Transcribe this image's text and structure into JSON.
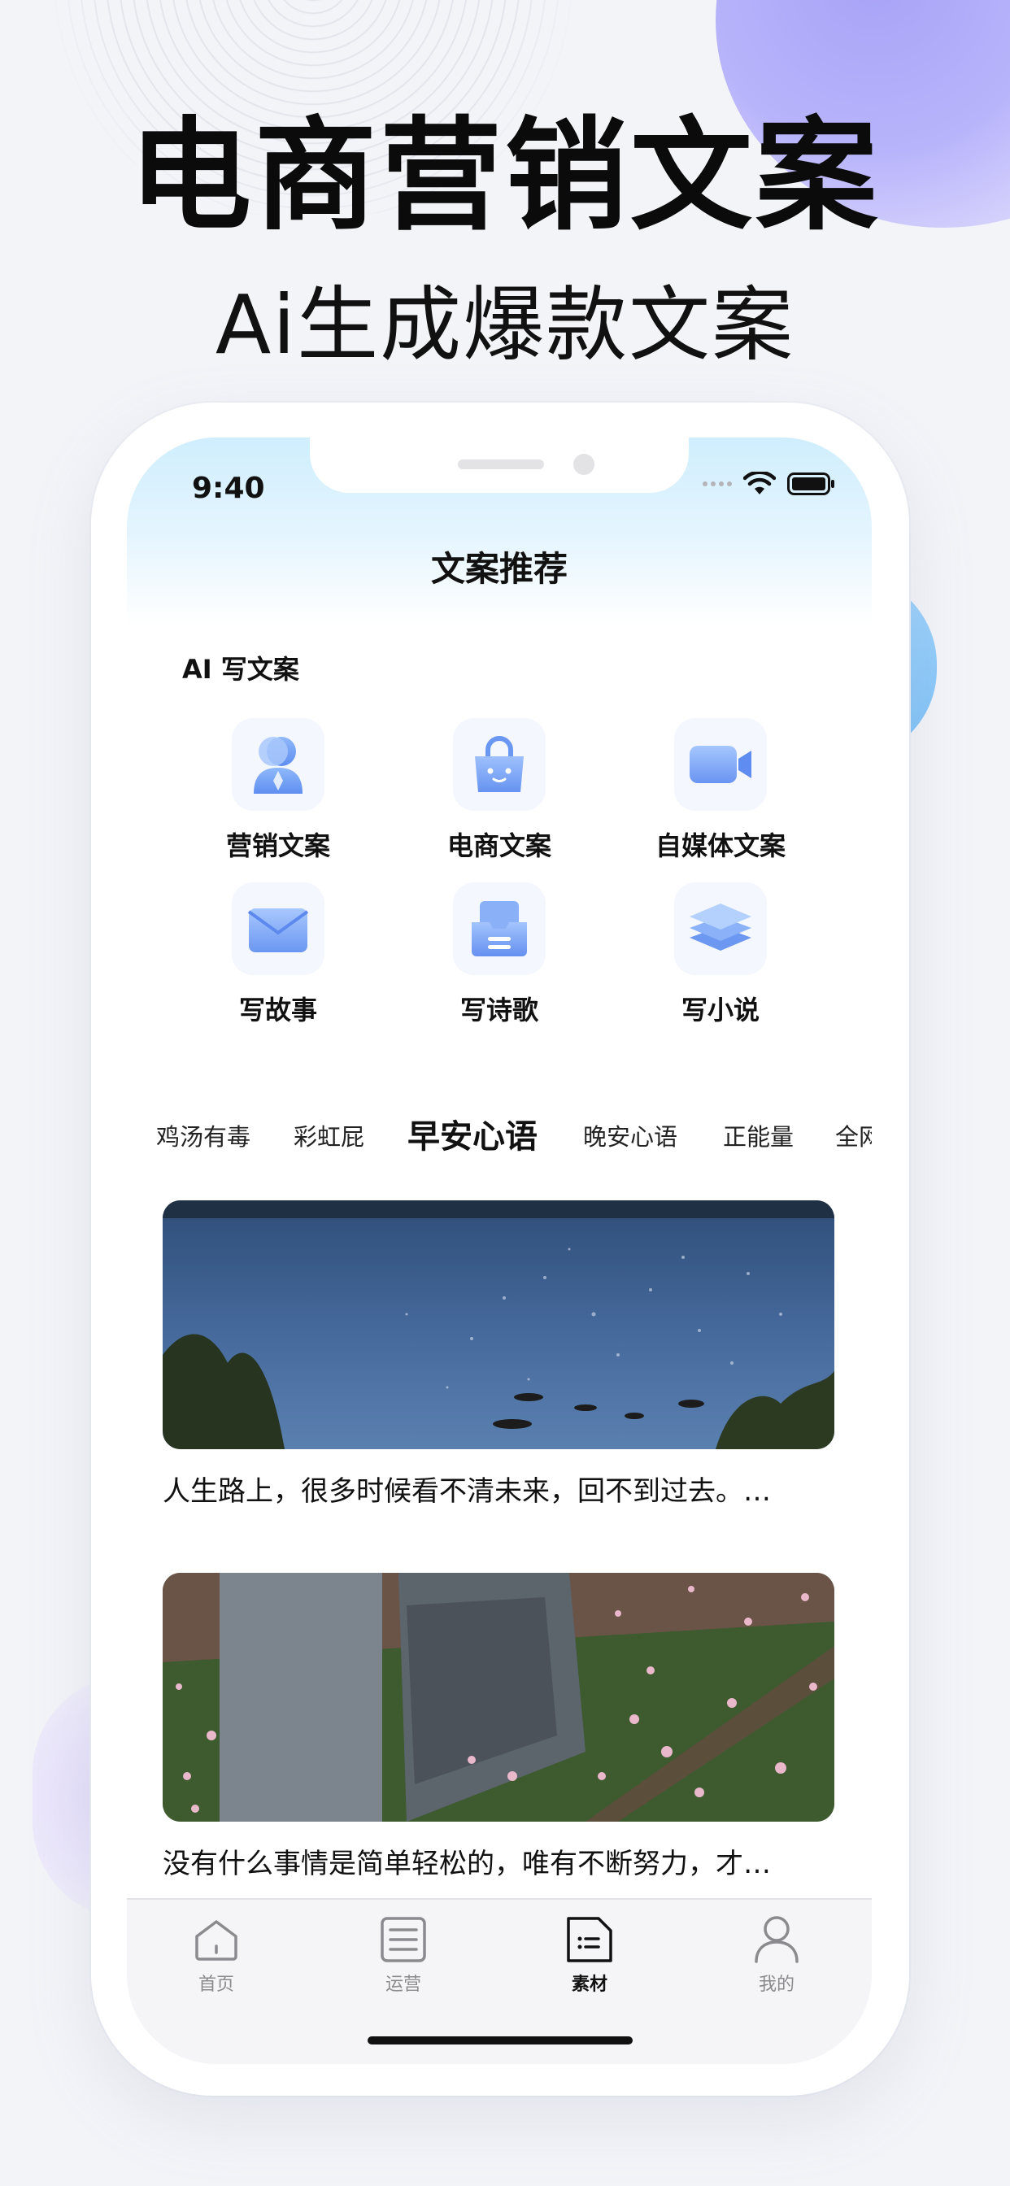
{
  "promo": {
    "headline": "电商营销文案",
    "subheadline": "Ai生成爆款文案"
  },
  "status_bar": {
    "time": "9:40"
  },
  "nav": {
    "title": "文案推荐"
  },
  "ai_section": {
    "title": "AI 写文案",
    "tools": [
      {
        "label": "营销文案",
        "icon": "person-icon"
      },
      {
        "label": "电商文案",
        "icon": "shopping-bag-icon"
      },
      {
        "label": "自媒体文案",
        "icon": "video-camera-icon"
      },
      {
        "label": "写故事",
        "icon": "envelope-icon"
      },
      {
        "label": "写诗歌",
        "icon": "inbox-icon"
      },
      {
        "label": "写小说",
        "icon": "layers-icon"
      }
    ]
  },
  "categories": {
    "items": [
      "鸡汤有毒",
      "彩虹屁",
      "早安心语",
      "晚安心语",
      "正能量",
      "全网"
    ],
    "active": "早安心语"
  },
  "feed": {
    "cards": [
      {
        "text": "人生路上，很多时候看不清未来，回不到过去。…",
        "image": "lake-photo"
      },
      {
        "text": "没有什么事情是简单轻松的，唯有不断努力，才…",
        "image": "trash-bin-petals-photo"
      }
    ]
  },
  "tabbar": {
    "items": [
      {
        "label": "首页",
        "icon": "home-icon"
      },
      {
        "label": "运营",
        "icon": "document-list-icon"
      },
      {
        "label": "素材",
        "icon": "material-file-icon"
      },
      {
        "label": "我的",
        "icon": "profile-icon"
      }
    ],
    "active": "素材"
  },
  "colors": {
    "accent_blue": "#6f9df5",
    "icon_tile_bg": "#f4f7fe",
    "header_gradient_top": "#cfeefd",
    "deco_purple": "#a8a3f6",
    "deco_blue": "#7cc0f7"
  }
}
